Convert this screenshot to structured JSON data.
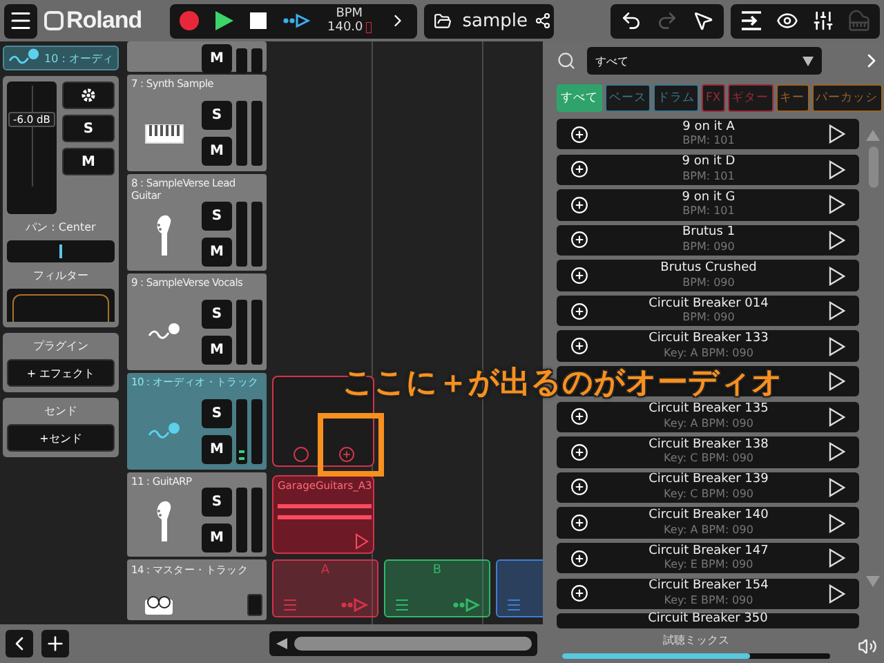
{
  "top_bar": {
    "logo": "Roland",
    "transport": {
      "recording": true,
      "bpm_label": "BPM",
      "bpm": "140.0"
    },
    "project": {
      "name": "sample"
    },
    "edit_tools": [
      {
        "kind": "undo",
        "disabled": false
      },
      {
        "kind": "redo",
        "disabled": true
      },
      {
        "kind": "pointer",
        "disabled": false
      }
    ],
    "view_tools": [
      {
        "kind": "list"
      },
      {
        "kind": "eye"
      },
      {
        "kind": "mixer"
      },
      {
        "kind": "piano"
      }
    ]
  },
  "inspector": {
    "tab": "10 : オーディ",
    "fader_reading": "-6.0 dB",
    "settings_solo": "S",
    "settings_mute": "M",
    "pan_label": "パン : Center",
    "pan": {
      "level": 0.5
    },
    "filter_label": "フィルター",
    "plugin": {
      "title": "プラグイン",
      "button": "+ エフェクト"
    },
    "send": {
      "title": "センド",
      "button": "+センド"
    }
  },
  "tracks": [
    {
      "kind": "partial",
      "mute": "M",
      "selected": false
    },
    {
      "kind": "synth",
      "name": "7 : Synth Sample",
      "solo": "S",
      "mute": "M",
      "selected": false
    },
    {
      "kind": "guitar",
      "name": "8 : SampleVerse Lead Guitar",
      "solo": "S",
      "mute": "M",
      "selected": false
    },
    {
      "kind": "mic",
      "name": "9 : SampleVerse Vocals",
      "solo": "S",
      "mute": "M",
      "selected": false
    },
    {
      "kind": "mic",
      "name": "10 : オーディオ・トラック",
      "solo": "S",
      "mute": "M",
      "selected": true,
      "level": 0.15,
      "clip": {
        "kind": "empty",
        "color": "#d2334a"
      }
    },
    {
      "kind": "guitar",
      "name": "11 : GuitARP",
      "solo": "S",
      "mute": "M",
      "selected": false,
      "clip": {
        "kind": "audio",
        "name": "GarageGuitars_A3",
        "color": "#d2334a"
      }
    }
  ],
  "master": {
    "name": "14 : マスター・トラック"
  },
  "scenes": [
    {
      "label": "A",
      "color": "#d2334a"
    },
    {
      "label": "B",
      "color": "#2fb86a"
    },
    {
      "color": "#3f7fd6"
    }
  ],
  "annotation": {
    "text": "ここに＋が出るのがオーディオ"
  },
  "browser": {
    "category": "すべて",
    "tags": [
      {
        "label": "すべて",
        "selected": true,
        "color": "#2fa36b"
      },
      {
        "label": "ベース",
        "selected": false,
        "color": "#3d7891"
      },
      {
        "label": "ドラム",
        "selected": false,
        "color": "#3d7891"
      },
      {
        "label": "FX",
        "selected": false,
        "color": "#9a2a3a"
      },
      {
        "label": "ギター",
        "selected": false,
        "color": "#9a2a3a"
      },
      {
        "label": "キー",
        "selected": false,
        "color": "#9a6428"
      },
      {
        "label": "パーカッシ",
        "selected": false,
        "color": "#9a6428"
      }
    ],
    "loops": [
      {
        "kind": "full",
        "title": "9 on it A",
        "info": "BPM: 101"
      },
      {
        "kind": "full",
        "title": "9 on it D",
        "info": "BPM: 101"
      },
      {
        "kind": "full",
        "title": "9 on it G",
        "info": "BPM: 101"
      },
      {
        "kind": "full",
        "title": "Brutus 1",
        "info": "BPM: 090"
      },
      {
        "kind": "full",
        "title": "Brutus Crushed",
        "info": "BPM: 090"
      },
      {
        "kind": "full",
        "title": "Circuit Breaker 014",
        "info": "BPM: 090"
      },
      {
        "kind": "full",
        "title": "Circuit Breaker 133",
        "info": "Key: A  BPM: 090"
      },
      {
        "kind": "covered"
      },
      {
        "kind": "full",
        "title": "Circuit Breaker 135",
        "info": "Key: A  BPM: 090"
      },
      {
        "kind": "full",
        "title": "Circuit Breaker 138",
        "info": "Key: C  BPM: 090"
      },
      {
        "kind": "full",
        "title": "Circuit Breaker 139",
        "info": "Key: C  BPM: 090"
      },
      {
        "kind": "full",
        "title": "Circuit Breaker 140",
        "info": "Key: A  BPM: 090"
      },
      {
        "kind": "full",
        "title": "Circuit Breaker 147",
        "info": "Key: E  BPM: 090"
      },
      {
        "kind": "full",
        "title": "Circuit Breaker 154",
        "info": "Key: E  BPM: 090"
      },
      {
        "kind": "partial",
        "title": "Circuit Breaker 350"
      }
    ],
    "preview": {
      "label": "試聴ミックス",
      "level": 0.7
    }
  }
}
